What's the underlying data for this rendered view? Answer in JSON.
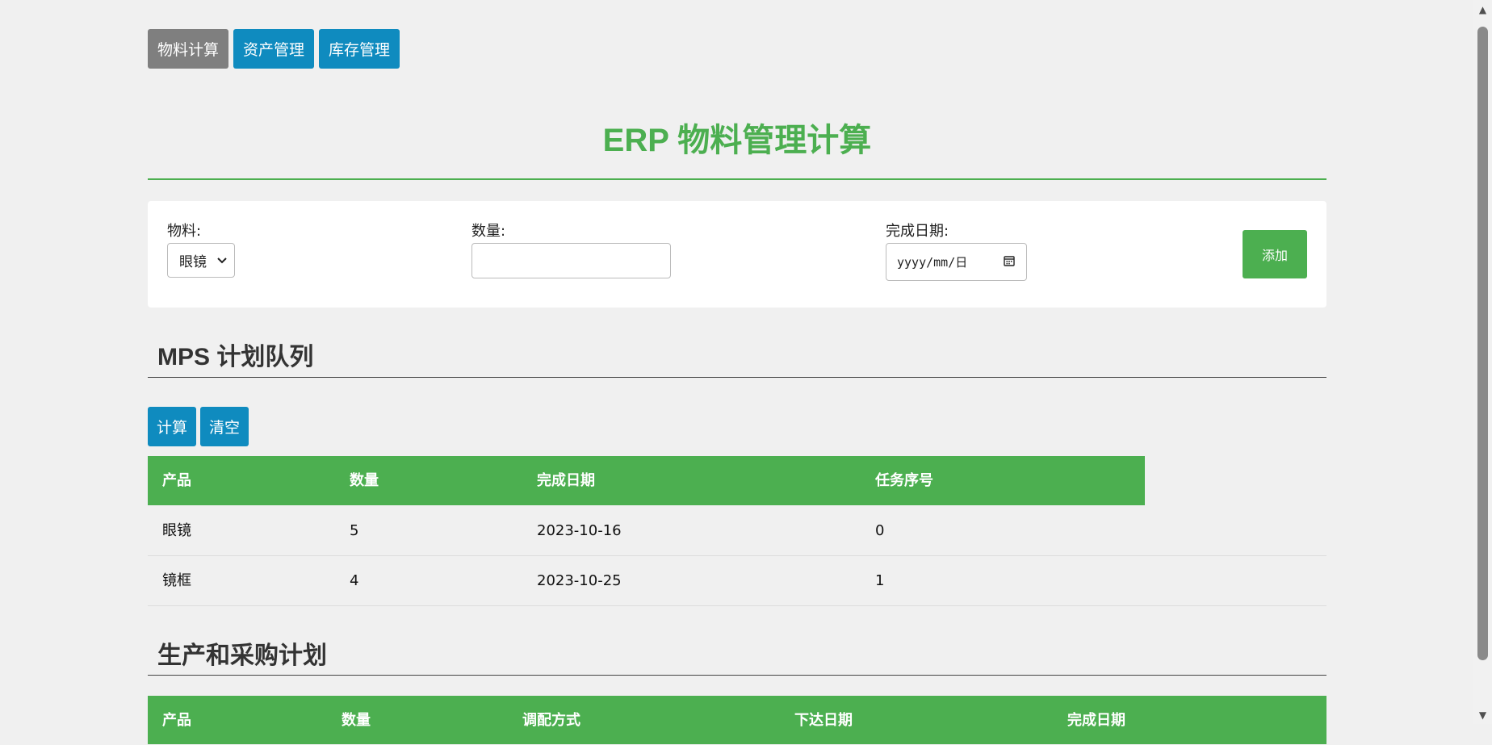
{
  "nav": {
    "tabs": [
      {
        "label": "物料计算",
        "active": true
      },
      {
        "label": "资产管理",
        "active": false
      },
      {
        "label": "库存管理",
        "active": false
      }
    ]
  },
  "page_title": "ERP 物料管理计算",
  "form": {
    "material_label": "物料:",
    "material_selected": "眼镜",
    "quantity_label": "数量:",
    "quantity_value": "",
    "date_label": "完成日期:",
    "date_placeholder": "yyyy/mm/日",
    "add_label": "添加"
  },
  "mps": {
    "title": "MPS 计划队列",
    "calc_label": "计算",
    "clear_label": "清空",
    "headers": [
      "产品",
      "数量",
      "完成日期",
      "任务序号"
    ],
    "rows": [
      [
        "眼镜",
        "5",
        "2023-10-16",
        "0"
      ],
      [
        "镜框",
        "4",
        "2023-10-25",
        "1"
      ]
    ]
  },
  "plan": {
    "title": "生产和采购计划",
    "headers": [
      "产品",
      "数量",
      "调配方式",
      "下达日期",
      "完成日期"
    ]
  },
  "colors": {
    "accent": "#4caf50",
    "button_blue": "#0f8bbf",
    "active_tab": "#7f7f7f"
  }
}
